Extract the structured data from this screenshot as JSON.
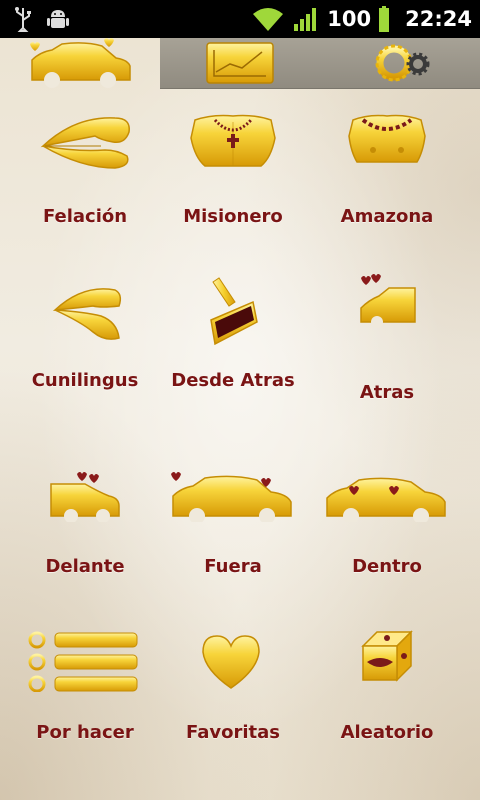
{
  "status_bar": {
    "icons": [
      "usb-icon",
      "android-debug-icon",
      "wifi-icon",
      "signal-icon",
      "battery-icon"
    ],
    "battery": "100",
    "time": "22:24"
  },
  "toolbar": {
    "home_icon": "car-icon",
    "stats_icon": "chart-icon",
    "settings_icon": "gear-icon"
  },
  "menu": [
    {
      "label": "Felación",
      "icon": "lips-icon"
    },
    {
      "label": "Misionero",
      "icon": "torso-rosary-icon"
    },
    {
      "label": "Amazona",
      "icon": "torso-necklace-icon"
    },
    {
      "label": "Cunilingus",
      "icon": "mouth-tongue-icon"
    },
    {
      "label": "Desde Atras",
      "icon": "lipstick-icon"
    },
    {
      "label": "Atras",
      "icon": "car-back-hearts-icon"
    },
    {
      "label": "Delante",
      "icon": "car-front-hearts-icon"
    },
    {
      "label": "Fuera",
      "icon": "car-side-hearts-icon"
    },
    {
      "label": "Dentro",
      "icon": "car-inside-hearts-icon"
    },
    {
      "label": "Por hacer",
      "icon": "list-icon"
    },
    {
      "label": "Favoritas",
      "icon": "heart-icon"
    },
    {
      "label": "Aleatorio",
      "icon": "dice-icon"
    }
  ],
  "colors": {
    "label": "#7a1414",
    "gold": "#f2c515",
    "heart": "#8a1a1a"
  }
}
